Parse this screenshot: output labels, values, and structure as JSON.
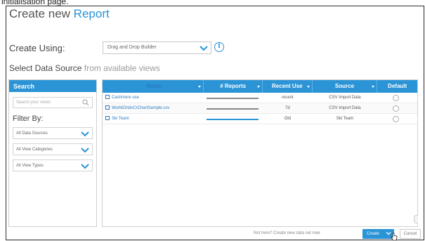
{
  "caption": "initialisation page.",
  "dialog": {
    "title_prefix": "Create new ",
    "title_accent": "Report"
  },
  "create_using": {
    "label": "Create Using:",
    "value": "Drag and Drop Builder"
  },
  "section": {
    "title": "Select Data Source ",
    "subtitle": "from available views"
  },
  "left_panel": {
    "header": "Search",
    "search_placeholder": "Search your views",
    "filter_title": "Filter By:",
    "filters": [
      "All Data Sources",
      "All View Categories",
      "All View Types"
    ]
  },
  "table": {
    "columns": [
      "Name",
      "# Reports",
      "Recent Use",
      "Source",
      "Default"
    ],
    "rows": [
      {
        "name": "Cashmere use",
        "reports_fraction": 1.0,
        "recent_use": "recent",
        "source": "CSV Import Data"
      },
      {
        "name": "WorldOrtdsCrChartSample.csv",
        "reports_fraction": 1.0,
        "recent_use": "7d",
        "source": "CSV Import Data"
      },
      {
        "name": "Ski Team",
        "reports_fraction": 1.0,
        "recent_use": "Old",
        "source": "Ski Team"
      }
    ]
  },
  "footer": {
    "note": "Not here? Create new data set now.",
    "create_label": "Create",
    "cancel_label": "Cancel"
  },
  "colors": {
    "accent": "#2a94d6",
    "bar_recent": "#888888",
    "bar_new": "#2a94d6"
  }
}
